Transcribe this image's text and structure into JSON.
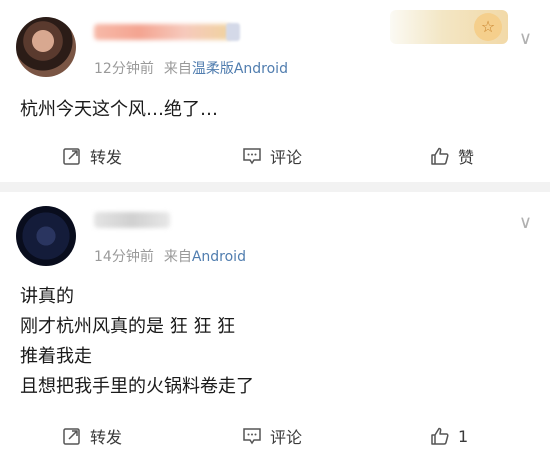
{
  "posts": [
    {
      "time": "12分钟前",
      "source_prefix": "来自",
      "client": "温柔版Android",
      "content": [
        "杭州今天这个风…绝了…"
      ],
      "actions": {
        "repost": "转发",
        "comment": "评论",
        "like": "赞"
      }
    },
    {
      "time": "14分钟前",
      "source_prefix": "来自",
      "client": "Android",
      "content": [
        "讲真的",
        "刚才杭州风真的是 狂 狂 狂",
        "推着我走",
        "且想把我手里的火锅料卷走了"
      ],
      "actions": {
        "repost": "转发",
        "comment": "评论",
        "like": "1"
      }
    }
  ],
  "medal_icon": "☆",
  "chevron_icon": "∨"
}
